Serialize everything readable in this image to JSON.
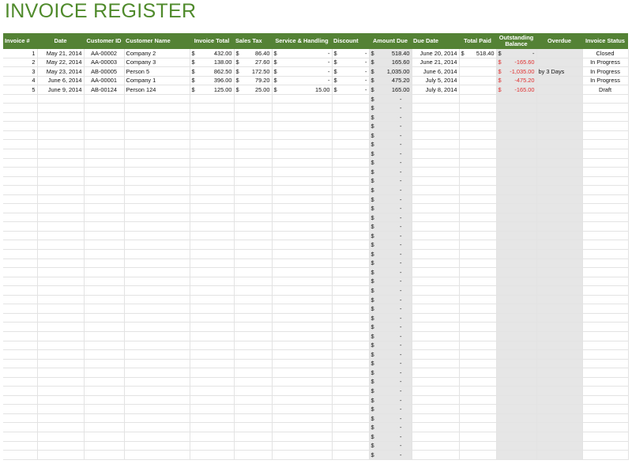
{
  "title": "INVOICE REGISTER",
  "headers": [
    "Invoice #",
    "Date",
    "Customer ID",
    "Customer Name",
    "Invoice Total",
    "Sales Tax",
    "Service & Handling",
    "Discount",
    "Amount Due",
    "Due Date",
    "Total Paid",
    "Outstanding Balance",
    "Overdue",
    "Invoice Status"
  ],
  "currency_symbol": "$",
  "dash": "-",
  "rows": [
    {
      "num": "1",
      "date": "May 21, 2014",
      "cid": "AA-00002",
      "name": "Company 2",
      "total": "432.00",
      "tax": "86.40",
      "service": "-",
      "discount": "-",
      "due": "518.40",
      "due_date": "June 20, 2014",
      "paid": "518.40",
      "outstanding": "-",
      "overdue": "",
      "status": "Closed",
      "negative": false
    },
    {
      "num": "2",
      "date": "May 22, 2014",
      "cid": "AA-00003",
      "name": "Company 3",
      "total": "138.00",
      "tax": "27.60",
      "service": "-",
      "discount": "-",
      "due": "165.60",
      "due_date": "June 21, 2014",
      "paid": "",
      "outstanding": "-165.60",
      "overdue": "",
      "status": "In Progress",
      "negative": true
    },
    {
      "num": "3",
      "date": "May 23, 2014",
      "cid": "AB-00005",
      "name": "Person 5",
      "total": "862.50",
      "tax": "172.50",
      "service": "-",
      "discount": "-",
      "due": "1,035.00",
      "due_date": "June 6, 2014",
      "paid": "",
      "outstanding": "-1,035.00",
      "overdue": "by 3 Days",
      "status": "In Progress",
      "negative": true
    },
    {
      "num": "4",
      "date": "June 6, 2014",
      "cid": "AA-00001",
      "name": "Company 1",
      "total": "396.00",
      "tax": "79.20",
      "service": "-",
      "discount": "-",
      "due": "475.20",
      "due_date": "July 5, 2014",
      "paid": "",
      "outstanding": "-475.20",
      "overdue": "",
      "status": "In Progress",
      "negative": true
    },
    {
      "num": "5",
      "date": "June 9, 2014",
      "cid": "AB-00124",
      "name": "Person 124",
      "total": "125.00",
      "tax": "25.00",
      "service": "15.00",
      "discount": "-",
      "due": "165.00",
      "due_date": "July 8, 2014",
      "paid": "",
      "outstanding": "-165.00",
      "overdue": "",
      "status": "Draft",
      "negative": true
    }
  ],
  "colors": {
    "header_bg": "#548235",
    "title": "#4f8a2b",
    "negative": "#e03030",
    "shaded": "#e6e6e6"
  }
}
